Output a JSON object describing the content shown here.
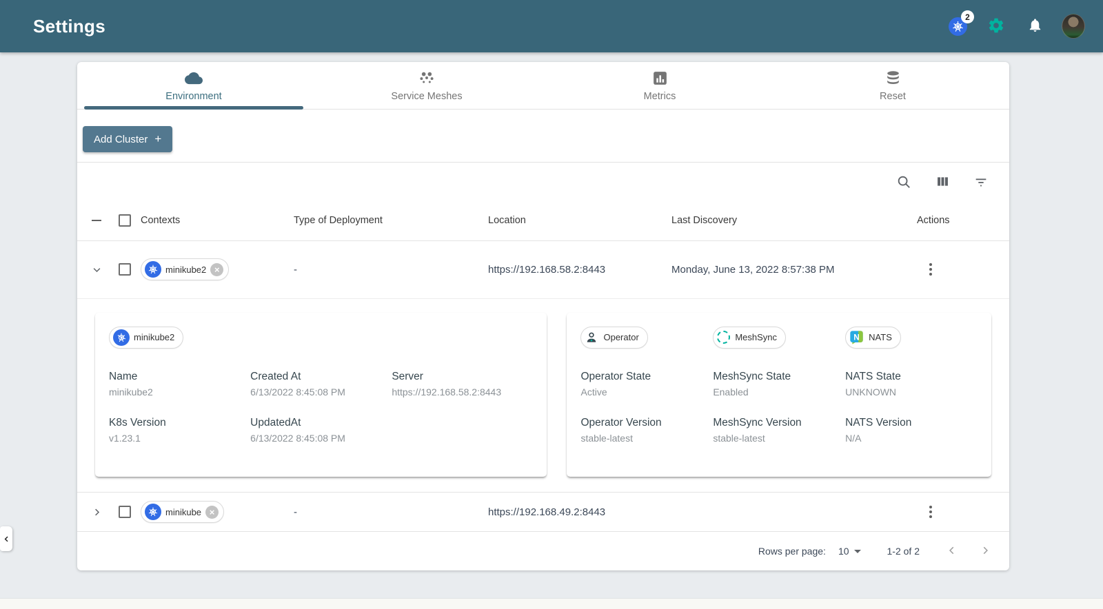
{
  "header": {
    "title": "Settings",
    "k8s_badge": "2"
  },
  "colors": {
    "appbar_bg": "#396679",
    "accent_green": "#00B39F",
    "k8s_blue": "#326CE5",
    "add_cluster_btn": "#53788F",
    "active_tab": "#3C6E7F",
    "nats_blue": "#27AAE1",
    "nats_green": "#8DC63F"
  },
  "tabs": [
    {
      "label": "Environment",
      "icon": "cloud-icon",
      "active": true
    },
    {
      "label": "Service Meshes",
      "icon": "service-mesh-icon",
      "active": false
    },
    {
      "label": "Metrics",
      "icon": "bar-chart-icon",
      "active": false
    },
    {
      "label": "Reset",
      "icon": "database-icon",
      "active": false
    }
  ],
  "toolbar": {
    "add_cluster_label": "Add Cluster",
    "add_cluster_plus": "+"
  },
  "table": {
    "headers": [
      "Contexts",
      "Type of Deployment",
      "Location",
      "Last Discovery",
      "Actions"
    ],
    "rows": [
      {
        "chip": "minikube2",
        "type": "-",
        "location": "https://192.168.58.2:8443",
        "discovery": "Monday, June 13, 2022 8:57:38 PM"
      },
      {
        "chip": "minikube",
        "type": "-",
        "location": "https://192.168.49.2:8443",
        "discovery": ""
      }
    ]
  },
  "details": {
    "cluster_chip": "minikube2",
    "cluster_fields": [
      {
        "label": "Name",
        "value": "minikube2"
      },
      {
        "label": "Created At",
        "value": "6/13/2022 8:45:08 PM"
      },
      {
        "label": "Server",
        "value": "https://192.168.58.2:8443"
      },
      {
        "label": "K8s Version",
        "value": "v1.23.1"
      },
      {
        "label": "UpdatedAt",
        "value": "6/13/2022 8:45:08 PM"
      }
    ],
    "component_chips": [
      "Operator",
      "MeshSync",
      "NATS"
    ],
    "component_fields": [
      {
        "label": "Operator State",
        "value": "Active"
      },
      {
        "label": "MeshSync State",
        "value": "Enabled"
      },
      {
        "label": "NATS State",
        "value": "UNKNOWN"
      },
      {
        "label": "Operator Version",
        "value": "stable-latest"
      },
      {
        "label": "MeshSync Version",
        "value": "stable-latest"
      },
      {
        "label": "NATS Version",
        "value": "N/A"
      }
    ]
  },
  "pagination": {
    "rows_per_page_label": "Rows per page:",
    "rows_per_page_value": "10",
    "range": "1-2 of 2"
  },
  "icons": {
    "nats_letter": "N"
  }
}
